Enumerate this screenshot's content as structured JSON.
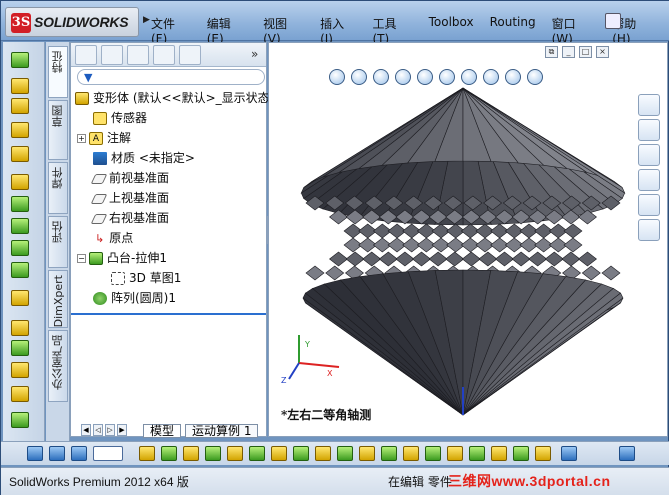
{
  "app": {
    "logo": "SOLIDWORKS",
    "menu": [
      "文件(F)",
      "编辑(E)",
      "视图(V)",
      "插入(I)",
      "工具(T)",
      "Toolbox",
      "Routing",
      "窗口(W)",
      "帮助(H)"
    ]
  },
  "vertical_tabs": [
    "特征",
    "草图",
    "焊件",
    "评估",
    "DimXpert",
    "办公室产品"
  ],
  "feature_tree": {
    "root": "变形体  (默认<<默认>_显示状态",
    "items": [
      {
        "label": "传感器",
        "icon": "sensor-icon"
      },
      {
        "label": "注解",
        "icon": "annotation-icon"
      },
      {
        "label": "材质 <未指定>",
        "icon": "material-icon"
      },
      {
        "label": "前视基准面",
        "icon": "plane-icon"
      },
      {
        "label": "上视基准面",
        "icon": "plane-icon"
      },
      {
        "label": "右视基准面",
        "icon": "plane-icon"
      },
      {
        "label": "原点",
        "icon": "origin-icon"
      },
      {
        "label": "凸台-拉伸1",
        "icon": "extrude-icon"
      },
      {
        "label": "3D 草图1",
        "icon": "sketch-icon"
      },
      {
        "label": "阵列(圆周)1",
        "icon": "pattern-icon"
      }
    ]
  },
  "bottom_tabs": [
    "模型",
    "运动算例 1"
  ],
  "viewport": {
    "view_label": "*左右二等角轴测"
  },
  "status": {
    "product": "SolidWorks Premium 2012 x64 版",
    "mode": "在编辑 零件",
    "watermark": "三维网www.3dportal.cn"
  },
  "colors": {
    "model_fill": "#6a6c74",
    "model_edge": "#1d1d22",
    "accent_blue": "#2a6fd0"
  }
}
